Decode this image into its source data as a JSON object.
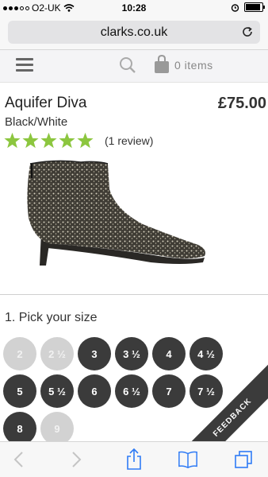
{
  "status_bar": {
    "carrier": "O2-UK",
    "time": "10:28",
    "signal_bars_filled": 3,
    "signal_bars_total": 5,
    "battery_level": 0.9
  },
  "browser": {
    "url": "clarks.co.uk"
  },
  "site_header": {
    "bag_count": "0 items"
  },
  "product": {
    "name": "Aquifer Diva",
    "price": "£75.00",
    "color": "Black/White",
    "rating": 5,
    "review_text": "(1 review)"
  },
  "size_section": {
    "heading": "1. Pick your size",
    "sizes": [
      {
        "label": "2",
        "available": false
      },
      {
        "label": "2 ½",
        "available": false
      },
      {
        "label": "3",
        "available": true
      },
      {
        "label": "3 ½",
        "available": true
      },
      {
        "label": "4",
        "available": true
      },
      {
        "label": "4 ½",
        "available": true
      },
      {
        "label": "5",
        "available": true
      },
      {
        "label": "5 ½",
        "available": true
      },
      {
        "label": "6",
        "available": true
      },
      {
        "label": "6 ½",
        "available": true
      },
      {
        "label": "7",
        "available": true
      },
      {
        "label": "7 ½",
        "available": true
      },
      {
        "label": "8",
        "available": true
      },
      {
        "label": "9",
        "available": false
      }
    ]
  },
  "feedback": {
    "label": "FEEDBACK"
  },
  "colors": {
    "star_green": "#8cc63f",
    "size_available": "#3b3b3b",
    "size_unavailable": "#d2d2d2",
    "ios_blue": "#2f7bf5"
  },
  "icons": {
    "menu": "hamburger-icon",
    "search": "search-icon",
    "bag": "shopping-bag-icon",
    "reload": "reload-icon",
    "back": "back-arrow-icon",
    "forward": "forward-arrow-icon",
    "share": "share-icon",
    "bookmarks": "bookmarks-icon",
    "tabs": "tabs-icon"
  }
}
